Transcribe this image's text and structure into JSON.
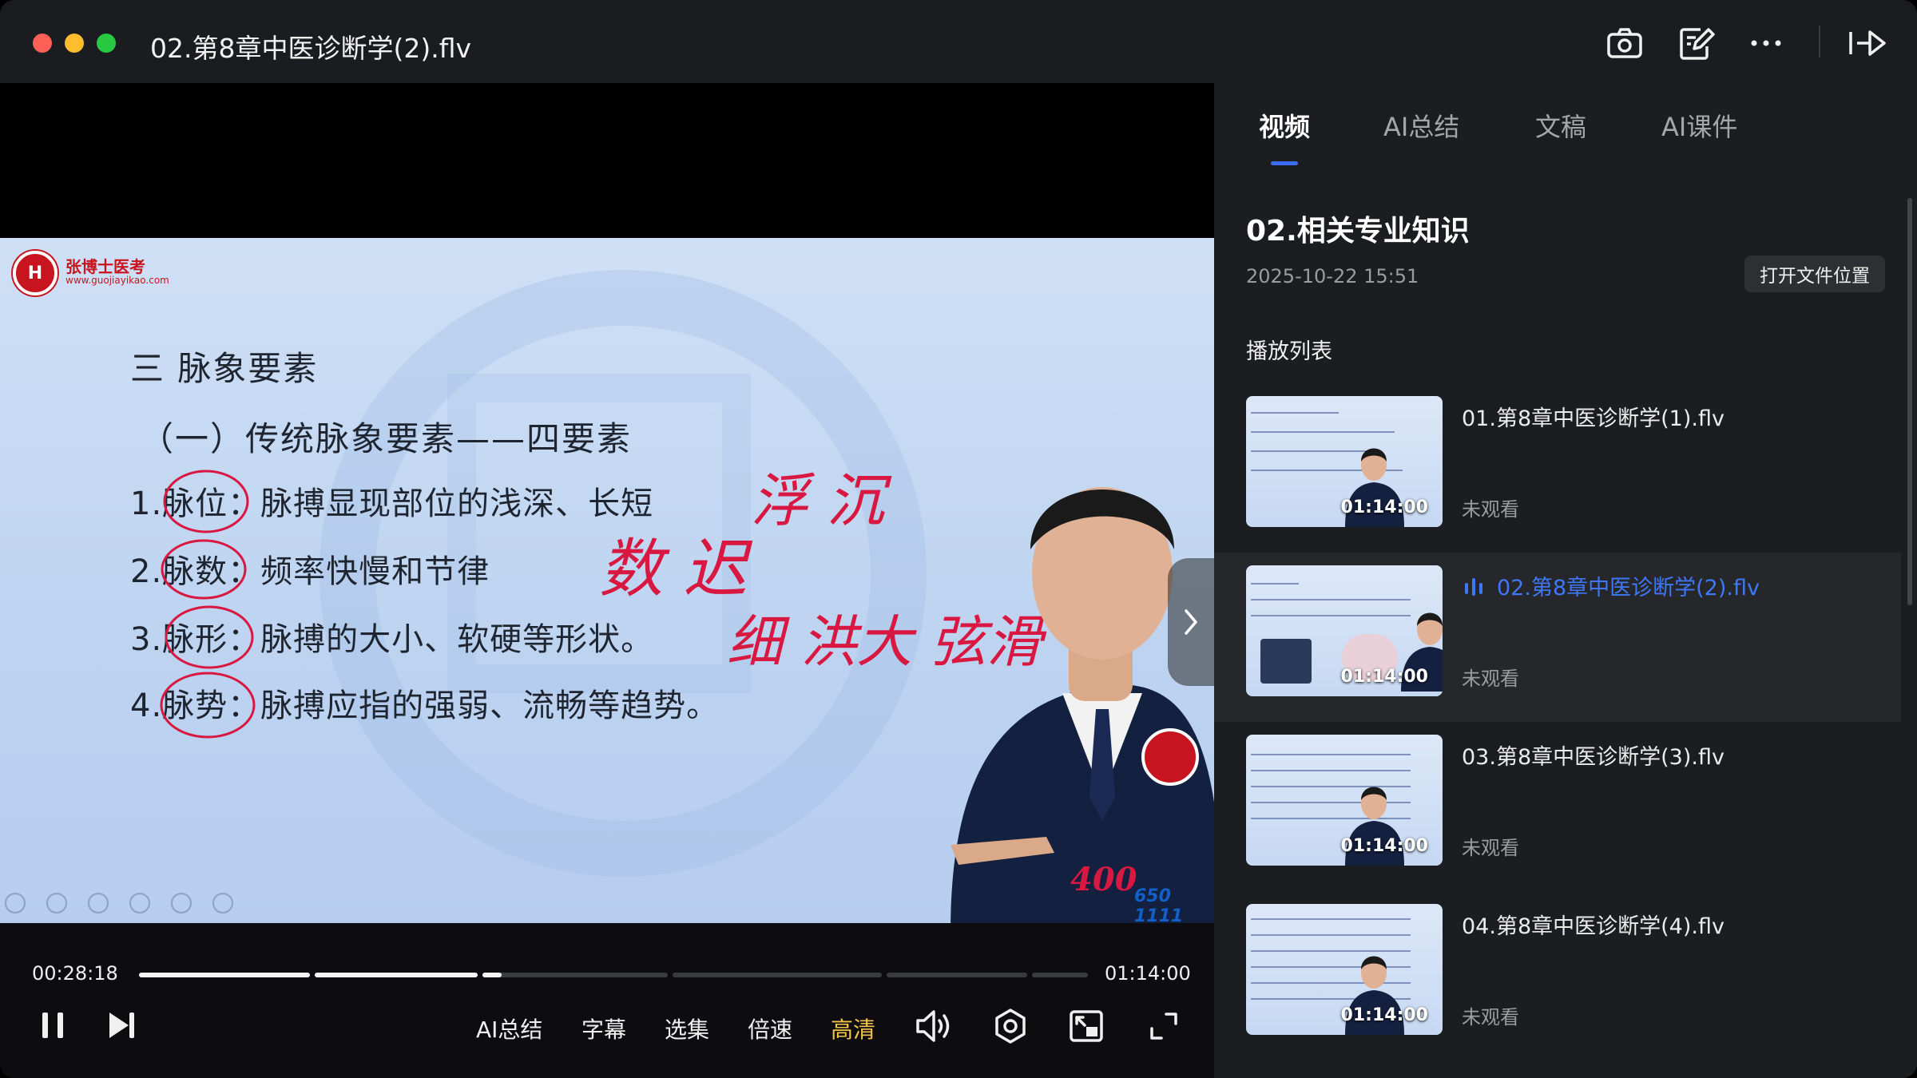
{
  "window": {
    "title": "02.第8章中医诊断学(2).flv"
  },
  "titlebar_icons": [
    "camera-icon",
    "edit-note-icon",
    "more-icon",
    "pin-window-icon"
  ],
  "slide": {
    "logo_text": "张博士医考",
    "logo_url": "www.guojiayikao.com",
    "title": "三   脉象要素",
    "subtitle": "（一）传统脉象要素——四要素",
    "lines": [
      "1.脉位：脉搏显现部位的浅深、长短",
      "2.脉数：频率快慢和节律",
      "3.脉形：脉搏的大小、软硬等形状。",
      "4.脉势：脉搏应指的强弱、流畅等趋势。"
    ],
    "annotations": [
      "浮 沉",
      "数 迟",
      "细 洪大 弦滑"
    ],
    "hotline": "400",
    "hotline_small": "650 1111"
  },
  "player": {
    "current_time": "00:28:18",
    "total_time": "01:14:00",
    "progress": 0.382,
    "buttons": {
      "ai_summary": "AI总结",
      "subtitles": "字幕",
      "episodes": "选集",
      "speed": "倍速",
      "quality": "高清"
    },
    "colors": {
      "active_quality": "#f5c44a"
    }
  },
  "panel": {
    "tabs": [
      {
        "label": "视频",
        "active": true
      },
      {
        "label": "AI总结",
        "active": false
      },
      {
        "label": "文稿",
        "active": false
      },
      {
        "label": "AI课件",
        "active": false
      }
    ],
    "section_title": "02.相关专业知识",
    "date": "2025-10-22 15:51",
    "open_location": "打开文件位置",
    "playlist_title": "播放列表",
    "playlist": [
      {
        "name": "01.第8章中医诊断学(1).flv",
        "duration": "01:14:00",
        "status": "未观看",
        "playing": false
      },
      {
        "name": "02.第8章中医诊断学(2).flv",
        "duration": "01:14:00",
        "status": "未观看",
        "playing": true
      },
      {
        "name": "03.第8章中医诊断学(3).flv",
        "duration": "01:14:00",
        "status": "未观看",
        "playing": false
      },
      {
        "name": "04.第8章中医诊断学(4).flv",
        "duration": "01:14:00",
        "status": "未观看",
        "playing": false
      }
    ],
    "colors": {
      "accent": "#3f78f7"
    }
  }
}
